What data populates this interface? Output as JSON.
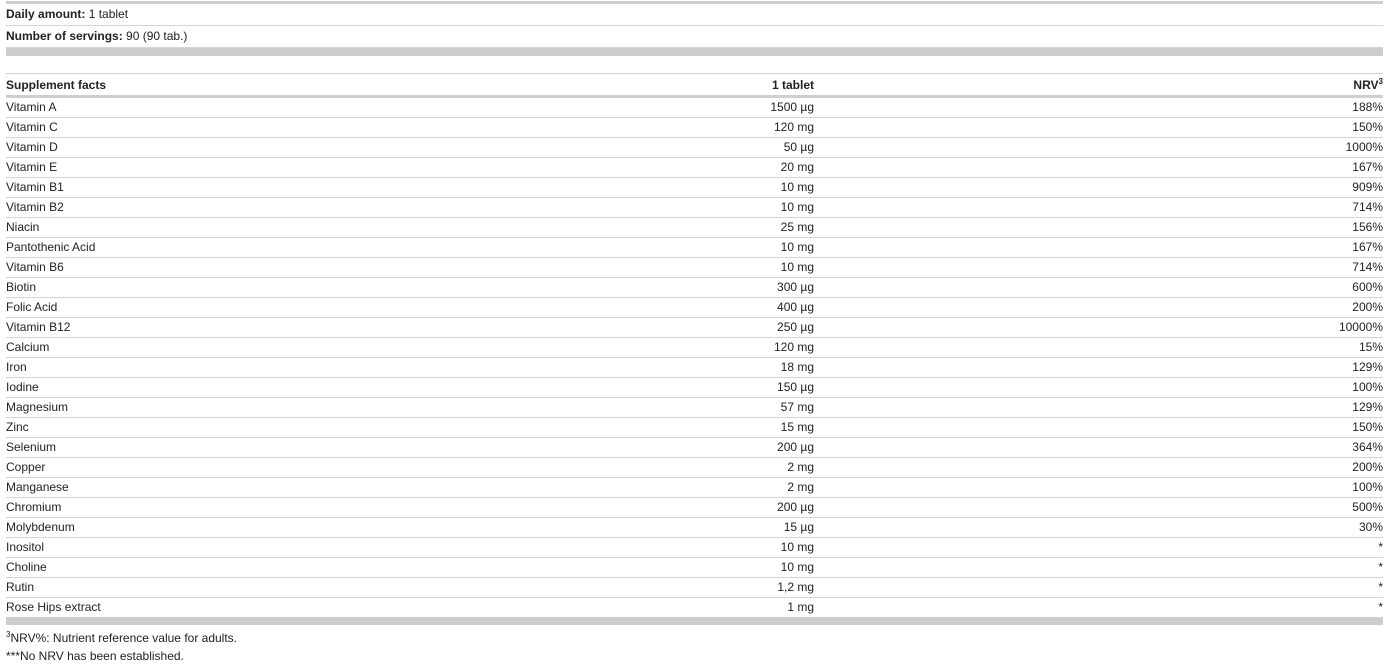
{
  "info": {
    "daily_amount_label": "Daily amount:",
    "daily_amount_value": "1 tablet",
    "servings_label": "Number of servings:",
    "servings_value": "90 (90 tab.)"
  },
  "table": {
    "headers": {
      "name": "Supplement facts",
      "amount": "1 tablet",
      "nrv": "NRV",
      "nrv_sup": "3"
    },
    "rows": [
      {
        "name": "Vitamin A",
        "amount": "1500 µg",
        "nrv": "188%"
      },
      {
        "name": "Vitamin C",
        "amount": "120 mg",
        "nrv": "150%"
      },
      {
        "name": "Vitamin D",
        "amount": "50 µg",
        "nrv": "1000%"
      },
      {
        "name": "Vitamin E",
        "amount": "20 mg",
        "nrv": "167%"
      },
      {
        "name": "Vitamin B1",
        "amount": "10 mg",
        "nrv": "909%"
      },
      {
        "name": "Vitamin B2",
        "amount": "10 mg",
        "nrv": "714%"
      },
      {
        "name": "Niacin",
        "amount": "25 mg",
        "nrv": "156%"
      },
      {
        "name": "Pantothenic Acid",
        "amount": "10 mg",
        "nrv": "167%"
      },
      {
        "name": "Vitamin B6",
        "amount": "10 mg",
        "nrv": "714%"
      },
      {
        "name": "Biotin",
        "amount": "300 µg",
        "nrv": "600%"
      },
      {
        "name": "Folic Acid",
        "amount": "400 µg",
        "nrv": "200%"
      },
      {
        "name": "Vitamin B12",
        "amount": "250 µg",
        "nrv": "10000%"
      },
      {
        "name": "Calcium",
        "amount": "120 mg",
        "nrv": "15%"
      },
      {
        "name": "Iron",
        "amount": "18 mg",
        "nrv": "129%"
      },
      {
        "name": "Iodine",
        "amount": "150 µg",
        "nrv": "100%"
      },
      {
        "name": "Magnesium",
        "amount": "57 mg",
        "nrv": "129%"
      },
      {
        "name": "Zinc",
        "amount": "15 mg",
        "nrv": "150%"
      },
      {
        "name": "Selenium",
        "amount": "200 µg",
        "nrv": "364%"
      },
      {
        "name": "Copper",
        "amount": "2 mg",
        "nrv": "200%"
      },
      {
        "name": "Manganese",
        "amount": "2 mg",
        "nrv": "100%"
      },
      {
        "name": "Chromium",
        "amount": "200 µg",
        "nrv": "500%"
      },
      {
        "name": "Molybdenum",
        "amount": "15 µg",
        "nrv": "30%"
      },
      {
        "name": "Inositol",
        "amount": "10 mg",
        "nrv": "*"
      },
      {
        "name": "Choline",
        "amount": "10 mg",
        "nrv": "*"
      },
      {
        "name": "Rutin",
        "amount": "1,2 mg",
        "nrv": "*"
      },
      {
        "name": "Rose Hips extract",
        "amount": "1 mg",
        "nrv": "*"
      }
    ]
  },
  "footnotes": {
    "nrv_sup": "3",
    "nrv_text": "NRV%: Nutrient reference value for adults.",
    "no_nrv_text": "***No NRV has been established."
  }
}
